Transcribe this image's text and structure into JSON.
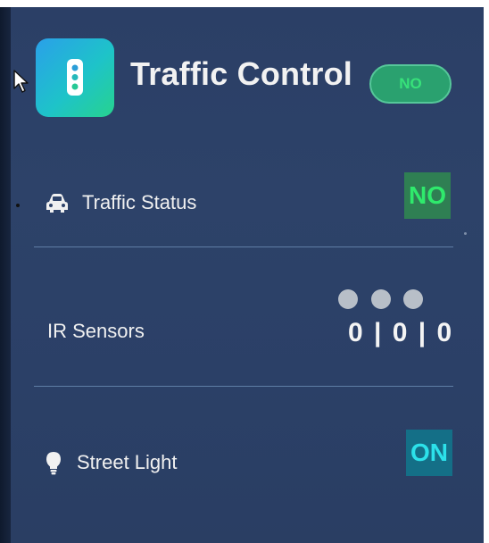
{
  "header": {
    "title": "Traffic Control",
    "status_pill": "NO"
  },
  "rows": {
    "traffic_status": {
      "label": "Traffic Status",
      "value": "NO",
      "icon": "car-icon"
    },
    "ir_sensors": {
      "label": "IR Sensors",
      "value": "0 | 0 | 0",
      "dot_count": 3
    },
    "street_light": {
      "label": "Street Light",
      "value": "ON",
      "icon": "lightbulb-icon"
    }
  },
  "colors": {
    "panel_bg": "#2d4269",
    "accent_green": "#2fea6c",
    "accent_cyan": "#2ce1ea",
    "pill_bg": "#2aa16f"
  }
}
